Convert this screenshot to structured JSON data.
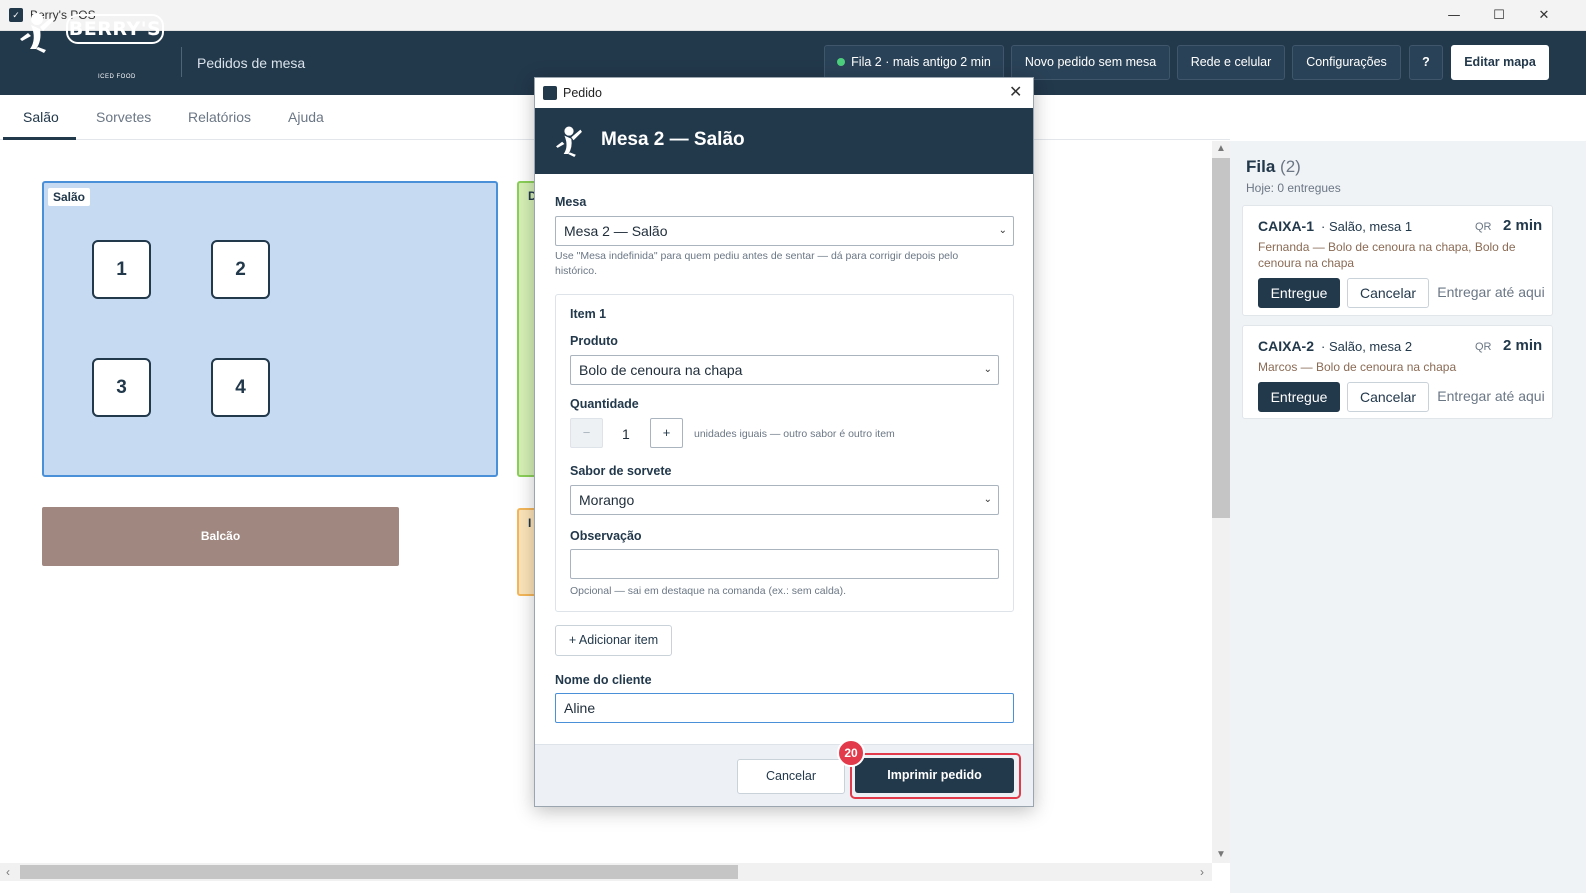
{
  "window": {
    "title": "Berry's POS",
    "controls": {
      "minimize": "—",
      "maximize": "☐",
      "close": "✕"
    }
  },
  "header": {
    "logo_text": "BERRY'S",
    "logo_sub": "ICED FOOD",
    "page_title": "Pedidos de mesa",
    "buttons": {
      "queue_status": "Fila 2 · mais antigo 2 min",
      "new_order": "Novo pedido sem mesa",
      "network": "Rede e celular",
      "settings": "Configurações",
      "help": "?",
      "edit_map": "Editar mapa"
    },
    "status_color": "#4ccf7c"
  },
  "tabs": [
    "Salão",
    "Sorvetes",
    "Relatórios",
    "Ajuda"
  ],
  "map": {
    "zone_salao": {
      "label": "Salão",
      "tables": [
        "1",
        "2",
        "3",
        "4"
      ]
    },
    "zone_green_peek": "D",
    "zone_orange_peek": "I",
    "counter": "Balcão"
  },
  "queue": {
    "title": "Fila",
    "count": "(2)",
    "subtitle": "Hoje: 0 entregues",
    "cards": [
      {
        "code": "CAIXA-1",
        "where": "· Salão, mesa 1",
        "source": "QR",
        "time": "2 min",
        "items": "Fernanda  —  Bolo de cenoura na chapa, Bolo de cenoura na chapa",
        "btn_deliver": "Entregue",
        "btn_cancel": "Cancelar",
        "btn_deliver_here": "Entregar até aqui"
      },
      {
        "code": "CAIXA-2",
        "where": "· Salão, mesa 2",
        "source": "QR",
        "time": "2 min",
        "items": "Marcos  —  Bolo de cenoura na chapa",
        "btn_deliver": "Entregue",
        "btn_cancel": "Cancelar",
        "btn_deliver_here": "Entregar até aqui"
      }
    ]
  },
  "modal": {
    "window_title": "Pedido",
    "close": "✕",
    "heading": "Mesa 2 — Salão",
    "mesa_label": "Mesa",
    "mesa_value": "Mesa 2 — Salão",
    "mesa_hint": "Use \"Mesa indefinida\" para quem pediu antes de sentar — dá para corrigir depois pelo histórico.",
    "item_title": "Item 1",
    "produto_label": "Produto",
    "produto_value": "Bolo de cenoura na chapa",
    "quantidade_label": "Quantidade",
    "qty_minus": "−",
    "qty_value": "1",
    "qty_plus": "+",
    "qty_hint": "unidades iguais — outro sabor é outro item",
    "sabor_label": "Sabor de sorvete",
    "sabor_value": "Morango",
    "obs_label": "Observação",
    "obs_value": "",
    "obs_hint": "Opcional — sai em destaque na comanda (ex.: sem calda).",
    "add_item": "+ Adicionar item",
    "cliente_label": "Nome do cliente",
    "cliente_value": "Aline",
    "btn_cancel": "Cancelar",
    "btn_print": "Imprimir pedido",
    "step_badge": "20",
    "highlight_color": "#e23a4a"
  }
}
